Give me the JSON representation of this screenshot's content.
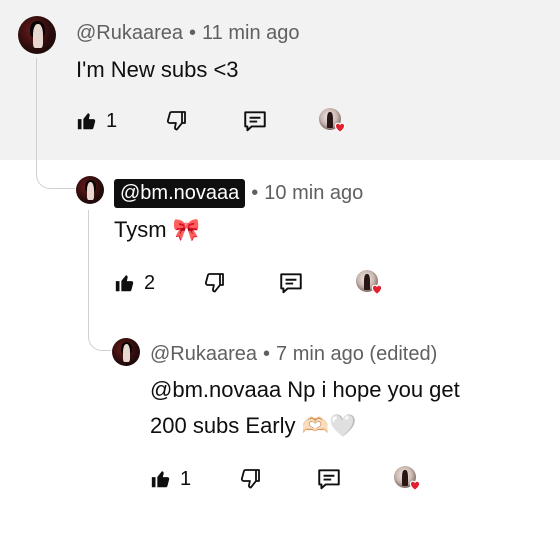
{
  "comments": [
    {
      "handle": "@Rukaarea",
      "time": "11 min ago",
      "text": "I'm New subs <3",
      "likes": "1"
    },
    {
      "handle": "@bm.novaaa",
      "time": "10 min ago",
      "text": "Tysm",
      "emoji": "🎀",
      "likes": "2"
    },
    {
      "handle": "@Rukaarea",
      "time": "7 min ago (edited)",
      "text_line1": "@bm.novaaa Np i hope you get",
      "text_line2": "200 subs Early",
      "emoji": "🫶🏻🤍",
      "likes": "1"
    }
  ],
  "separator": "•",
  "icons": {
    "like": "thumbs-up-icon",
    "dislike": "thumbs-down-icon",
    "reply": "reply-comment-icon",
    "creator_heart": "creator-heart-badge"
  },
  "colors": {
    "highlight_bg": "#f2f2f2",
    "meta_text": "#606060",
    "heart": "#e0202e",
    "handle_chip_bg": "#0f0f0f"
  }
}
